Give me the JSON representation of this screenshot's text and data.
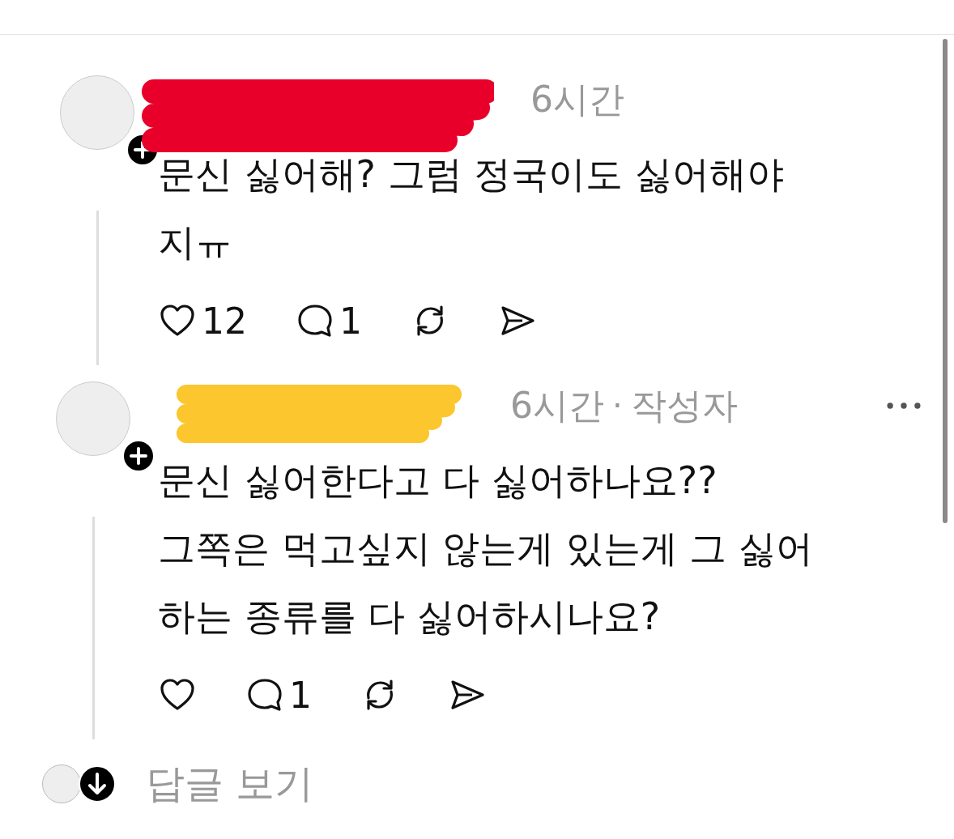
{
  "comments": [
    {
      "time": "6시간",
      "lines": [
        "문신 싫어해? 그럼 정국이도 싫어해야",
        "지ㅠ"
      ],
      "likes": "12",
      "replies": "1",
      "menu": false
    },
    {
      "time": "6시간",
      "separator": "·",
      "author_label": "작성자",
      "lines": [
        "문신 싫어한다고 다 싫어하나요??",
        "그쪽은 먹고싶지 않는게 있는게 그 싫어",
        "하는 종류를 다 싫어하시나요?"
      ],
      "replies": "1",
      "menu": true
    }
  ],
  "view_replies": {
    "label": "답글 보기"
  }
}
